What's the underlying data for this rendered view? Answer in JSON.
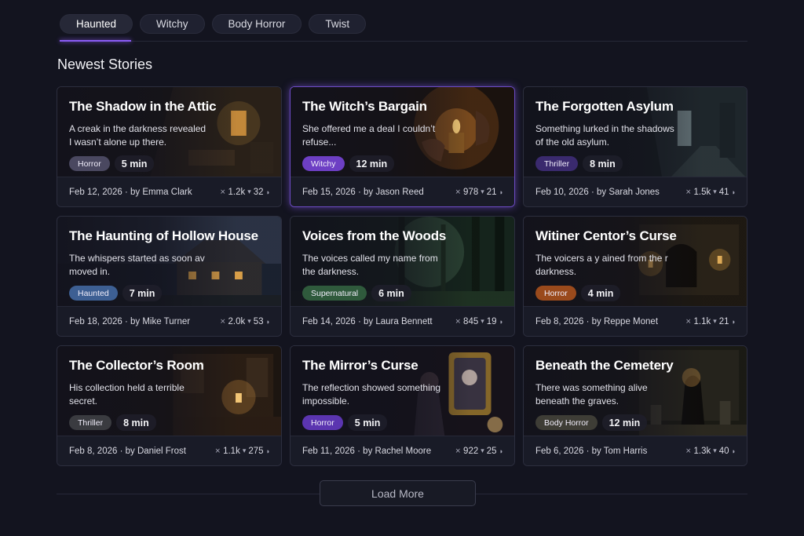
{
  "tabs": [
    {
      "label": "Haunted"
    },
    {
      "label": "Witchy"
    },
    {
      "label": "Body Horror"
    },
    {
      "label": "Twist"
    }
  ],
  "section_title": "Newest Stories",
  "stories": [
    {
      "title": "The Shadow in the Attic",
      "desc": "A creak in the darkness revealed I wasn’t alone up there.",
      "genre": "Horror",
      "genre_color": "#4a4860",
      "duration": "5 min",
      "date": "Feb 12, 2026",
      "by": "by Emma Clark",
      "views": "1.2k",
      "comments": "32",
      "scene": "attic"
    },
    {
      "title": "The Witch’s Bargain",
      "desc": "She offered me a deal I couldn’t refuse...",
      "genre": "Witchy",
      "genre_color": "#6d3fc4",
      "duration": "12 min",
      "date": "Feb 15, 2026",
      "by": "by Jason Reed",
      "views": "978",
      "comments": "21",
      "scene": "candle"
    },
    {
      "title": "The Forgotten Asylum",
      "desc": "Something lurked in the shadows of the old asylum.",
      "genre": "Thriller",
      "genre_color": "#3a2a6e",
      "duration": "8 min",
      "date": "Feb 10, 2026",
      "by": "by Sarah Jones",
      "views": "1.5k",
      "comments": "41",
      "scene": "hall"
    },
    {
      "title": "The Haunting of Hollow House",
      "desc": "The whispers started as soon av moved in.",
      "genre": "Haunted",
      "genre_color": "#3d5f93",
      "duration": "7 min",
      "date": "Feb 18, 2026",
      "by": "by Mike Turner",
      "views": "2.0k",
      "comments": "53",
      "scene": "house"
    },
    {
      "title": "Voices from the Woods",
      "desc": "The voices called my name from the darkness.",
      "genre": "Supernatural",
      "genre_color": "#2f5a3c",
      "duration": "6 min",
      "date": "Feb 14, 2026",
      "by": "by Laura Bennett",
      "views": "845",
      "comments": "19",
      "scene": "woods"
    },
    {
      "title": "Witiner Centor’s Curse",
      "desc": "The voicers a y ained from the r darkness.",
      "genre": "Horror",
      "genre_color": "#9a4a1c",
      "duration": "4 min",
      "date": "Feb 8, 2026",
      "by": "by Reppe Monet",
      "views": "1.1k",
      "comments": "21",
      "scene": "ruins"
    },
    {
      "title": "The Collector’s Room",
      "desc": "His collection held a terrible secret.",
      "genre": "Thriller",
      "genre_color": "#3a3b40",
      "duration": "8 min",
      "date": "Feb 8, 2026",
      "by": "by Daniel Frost",
      "views": "1.1k",
      "comments": "275",
      "scene": "room"
    },
    {
      "title": "The Mirror’s Curse",
      "desc": "The reflection showed something impossible.",
      "genre": "Horror",
      "genre_color": "#5b35b0",
      "duration": "5 min",
      "date": "Feb 11, 2026",
      "by": "by Rachel Moore",
      "views": "922",
      "comments": "25",
      "scene": "mirror"
    },
    {
      "title": "Beneath the Cemetery",
      "desc": "There was something alive beneath the graves.",
      "genre": "Body Horror",
      "genre_color": "#3e3d36",
      "duration": "12 min",
      "date": "Feb 6, 2026",
      "by": "by Tom Harris",
      "views": "1.3k",
      "comments": "40",
      "scene": "cemetery"
    }
  ],
  "load_more_label": "Load More"
}
